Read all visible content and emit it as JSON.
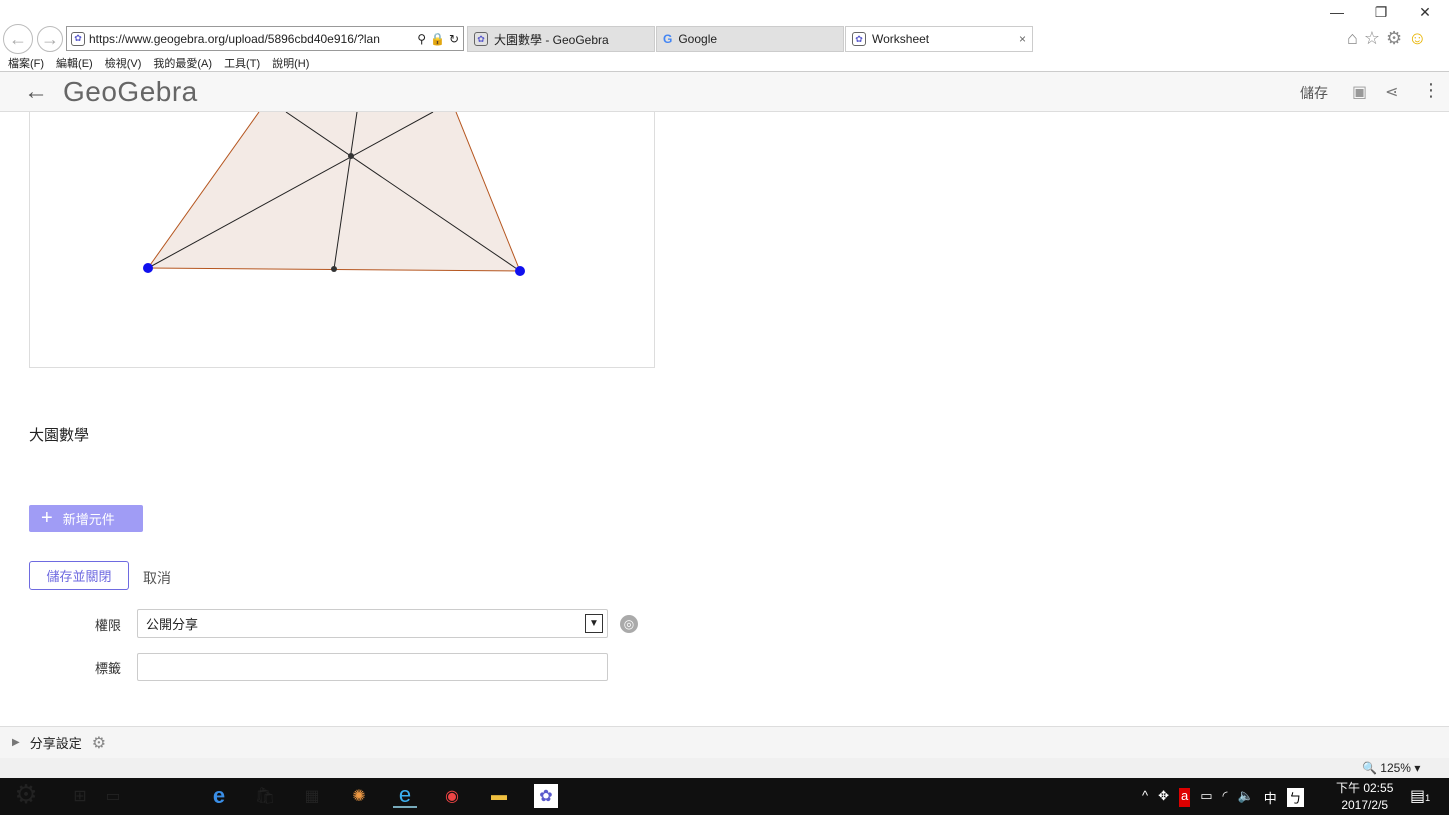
{
  "browser": {
    "url": "https://www.geogebra.org/upload/5896cbd40e916/?lan",
    "tabs": [
      {
        "label": "大園數學 - GeoGebra"
      },
      {
        "label": "Google"
      },
      {
        "label": "Worksheet"
      }
    ],
    "menu": [
      "檔案(F)",
      "編輯(E)",
      "檢視(V)",
      "我的最愛(A)",
      "工具(T)",
      "說明(H)"
    ],
    "zoom": "125%"
  },
  "app": {
    "logo": "GeoGebra",
    "save": "儲存"
  },
  "content": {
    "author": "大園數學",
    "add_element": "新增元件",
    "save_close": "儲存並關閉",
    "cancel": "取消",
    "permission_label": "權限",
    "permission_value": "公開分享",
    "tags_label": "標籤",
    "tags_value": "",
    "share_settings": "分享設定"
  },
  "taskbar": {
    "time": "下午 02:55",
    "date": "2017/2/5",
    "ime": "中",
    "notifications": "1"
  },
  "colors": {
    "accent": "#a09cf5",
    "triangle_fill": "#f3eae5",
    "triangle_edge": "#b5551e",
    "vertex": "#1010ee"
  }
}
